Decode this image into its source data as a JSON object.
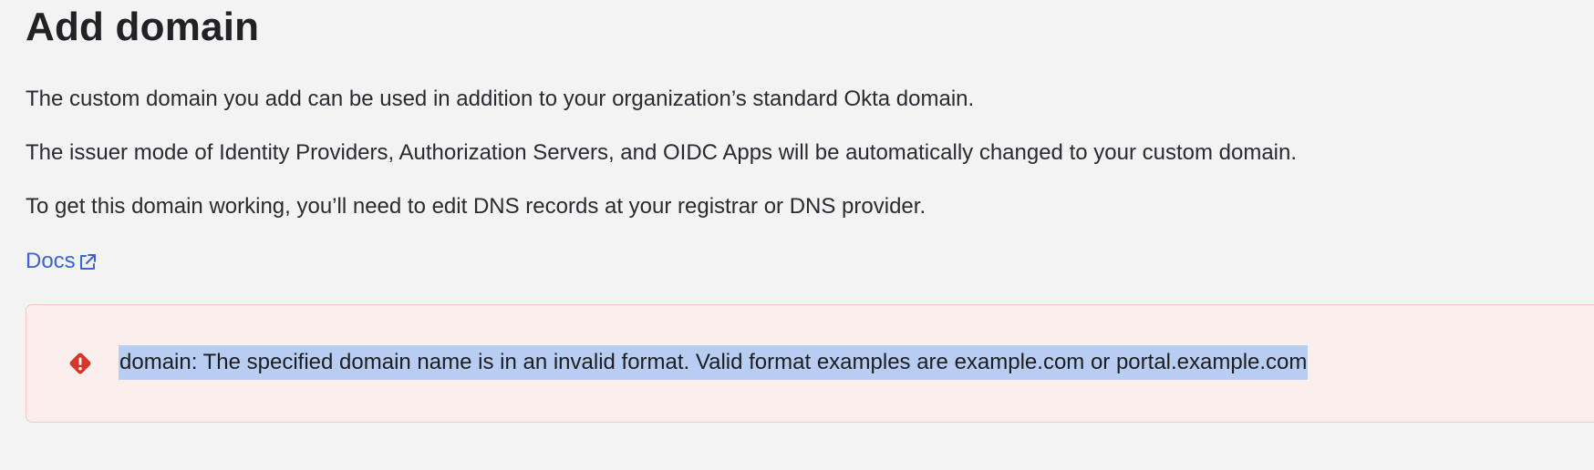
{
  "page": {
    "title": "Add domain",
    "paragraphs": [
      "The custom domain you add can be used in addition to your organization’s standard Okta domain.",
      "The issuer mode of Identity Providers, Authorization Servers, and OIDC Apps will be automatically changed to your custom domain.",
      "To get this domain working, you’ll need to edit DNS records at your registrar or DNS provider."
    ],
    "docs_link": {
      "label": "Docs",
      "icon": "external-link-icon"
    }
  },
  "error": {
    "icon": "error-diamond-icon",
    "message": "domain: The specified domain name is in an invalid format. Valid format examples are example.com or portal.example.com"
  },
  "colors": {
    "background": "#f3f3f3",
    "link": "#3b63d1",
    "error_background": "#fbefed",
    "error_border": "#f3c9c2",
    "error_icon": "#d5382b",
    "selection_highlight": "#b7cdf1"
  }
}
